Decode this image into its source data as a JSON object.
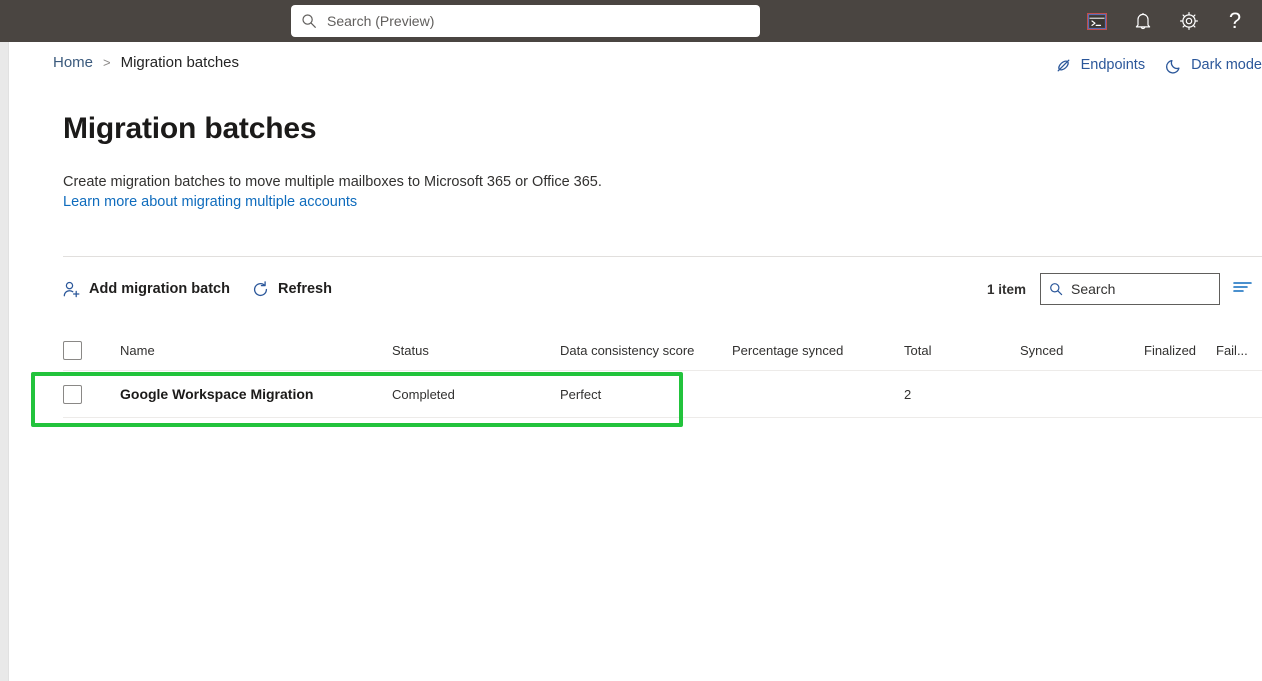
{
  "suite_bar": {
    "search": {
      "placeholder": "Search (Preview)",
      "icon": "search-icon"
    },
    "actions": [
      {
        "name": "cloud-shell-icon",
        "label": "Cloud Shell"
      },
      {
        "name": "notifications-bell-icon",
        "label": "Notifications"
      },
      {
        "name": "settings-gear-icon",
        "label": "Settings"
      },
      {
        "name": "help-question-icon",
        "label": "Help",
        "glyph": "?"
      }
    ]
  },
  "breadcrumb": {
    "home": "Home",
    "separator": ">",
    "current": "Migration batches"
  },
  "page_actions": [
    {
      "icon": "endpoints-plug-icon",
      "label": "Endpoints"
    },
    {
      "icon": "dark-mode-moon-icon",
      "label": "Dark mode"
    }
  ],
  "header": {
    "title": "Migration batches",
    "description": "Create migration batches to move multiple mailboxes to Microsoft 365 or Office 365.",
    "learn_more": "Learn more about migrating multiple accounts"
  },
  "commandbar": {
    "add_batch": {
      "label": "Add migration batch",
      "icon": "add-user-icon"
    },
    "refresh": {
      "label": "Refresh",
      "icon": "refresh-icon"
    },
    "item_count": "1 item",
    "search": {
      "placeholder": "Search",
      "value": "",
      "icon": "search-icon"
    },
    "filter": {
      "icon": "filter-lines-icon",
      "label": "Filter"
    }
  },
  "table": {
    "columns": [
      "Name",
      "Status",
      "Data consistency score",
      "Percentage synced",
      "Total",
      "Synced",
      "Finalized",
      "Fail..."
    ],
    "rows": [
      {
        "name": "Google Workspace Migration",
        "status": "Completed",
        "data_consistency_score": "Perfect",
        "percentage_synced": "",
        "total": "2",
        "synced": "",
        "finalized": "",
        "failed": ""
      }
    ]
  },
  "colors": {
    "suite_bar": "#4a4541",
    "accent_link": "#0f6cbd",
    "page_action_blue": "#2b579a",
    "highlight_green": "#22c33c",
    "border": "#edebe9"
  }
}
